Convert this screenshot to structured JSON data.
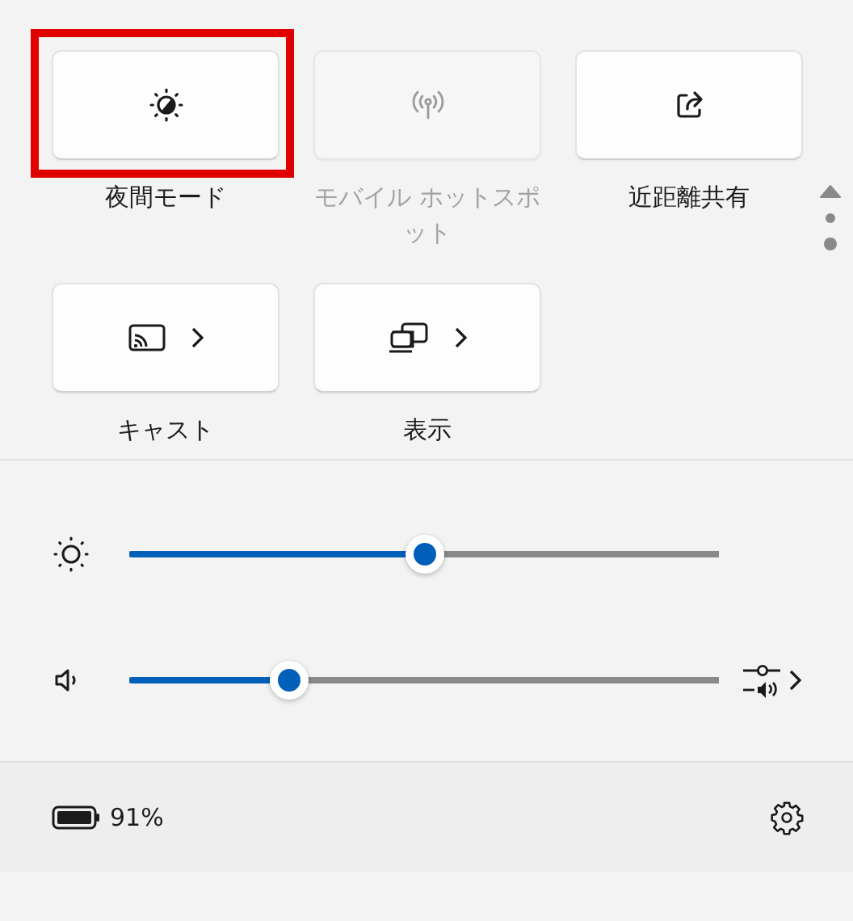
{
  "tiles": [
    {
      "kind": "toggle",
      "label": "夜間モード",
      "disabled": false,
      "highlighted": true
    },
    {
      "kind": "toggle",
      "label": "モバイル ホットスポット",
      "disabled": true,
      "highlighted": false
    },
    {
      "kind": "toggle",
      "label": "近距離共有",
      "disabled": false,
      "highlighted": false
    },
    {
      "kind": "expand",
      "label": "キャスト",
      "disabled": false,
      "highlighted": false
    },
    {
      "kind": "expand",
      "label": "表示",
      "disabled": false,
      "highlighted": false
    }
  ],
  "pages": [
    {
      "selected": false
    },
    {
      "selected": true
    }
  ],
  "sliders": [
    {
      "kind": "brightness",
      "level": 0.5
    },
    {
      "kind": "volume",
      "level": 0.27
    }
  ],
  "battery": {
    "reading": "91%"
  }
}
